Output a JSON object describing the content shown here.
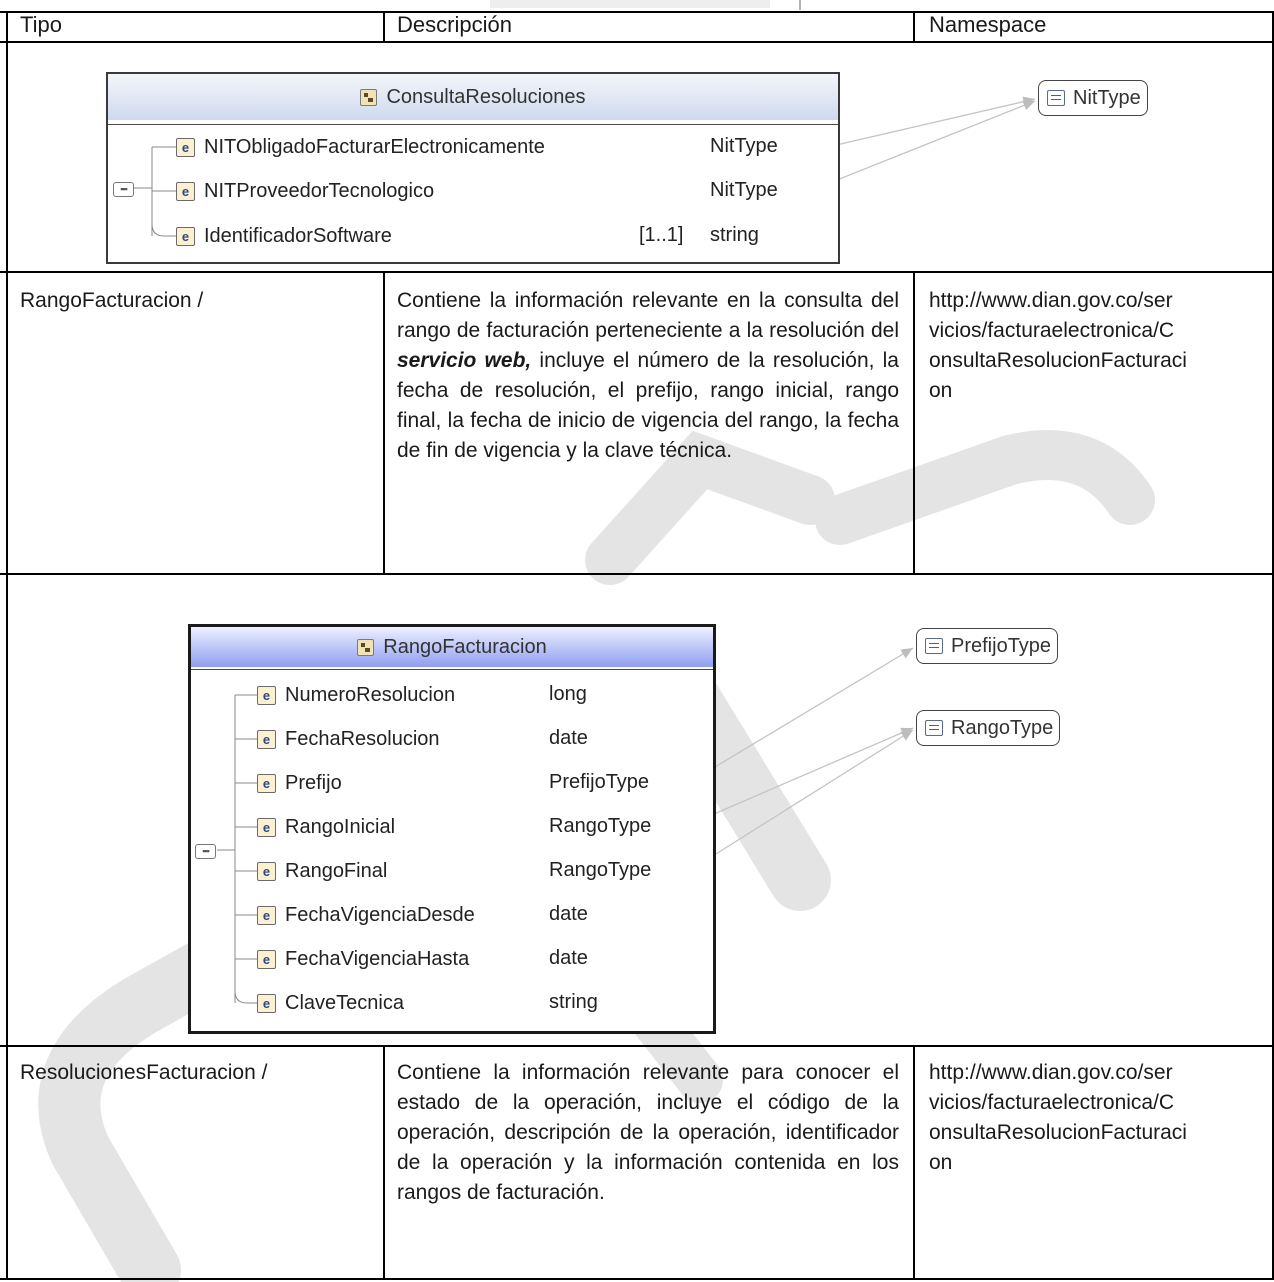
{
  "header": {
    "tipo": "Tipo",
    "descripcion": "Descripción",
    "namespace": "Namespace"
  },
  "diagram1": {
    "title": "ConsultaResoluciones",
    "elements": [
      {
        "name": "NITObligadoFacturarElectronicamente",
        "cardinality": "",
        "type": "NitType"
      },
      {
        "name": "NITProveedorTecnologico",
        "cardinality": "",
        "type": "NitType"
      },
      {
        "name": "IdentificadorSoftware",
        "cardinality": "[1..1]",
        "type": "string"
      }
    ],
    "types": [
      "NitType"
    ],
    "sequence_icon": "sequence-icon",
    "element_icon_label": "e",
    "colors": {
      "title_gradient_top": "#f4f6fb",
      "title_gradient_bottom": "#cfd9ee"
    }
  },
  "row1": {
    "tipo": "RangoFacturacion /",
    "descripcion_pre": "Contiene la información relevante en la consulta del rango de facturación perteneciente a la resolución del ",
    "descripcion_em": "servicio web,",
    "descripcion_post": " incluye el número de la resolución, la fecha de resolución, el prefijo, rango inicial, rango final, la fecha de inicio de vigencia del rango, la fecha de fin de vigencia y la clave técnica.",
    "namespace_lines": [
      "http://www.dian.gov.co/ser",
      "vicios/facturaelectronica/C",
      "onsultaResolucionFacturaci",
      "on"
    ]
  },
  "diagram2": {
    "title": "RangoFacturacion",
    "elements": [
      {
        "name": "NumeroResolucion",
        "type": "long"
      },
      {
        "name": "FechaResolucion",
        "type": "date"
      },
      {
        "name": "Prefijo",
        "type": "PrefijoType"
      },
      {
        "name": "RangoInicial",
        "type": "RangoType"
      },
      {
        "name": "RangoFinal",
        "type": "RangoType"
      },
      {
        "name": "FechaVigenciaDesde",
        "type": "date"
      },
      {
        "name": "FechaVigenciaHasta",
        "type": "date"
      },
      {
        "name": "ClaveTecnica",
        "type": "string"
      }
    ],
    "types": [
      "PrefijoType",
      "RangoType"
    ],
    "colors": {
      "title_gradient_top": "#eef0ff",
      "title_gradient_bottom": "#8f9ef0"
    }
  },
  "row2": {
    "tipo": "ResolucionesFacturacion /",
    "descripcion": "Contiene la información relevante para conocer el estado de la operación, incluye el código de la operación, descripción de la operación, identificador de la operación y la información contenida en los rangos de facturación.",
    "namespace_lines": [
      "http://www.dian.gov.co/ser",
      "vicios/facturaelectronica/C",
      "onsultaResolucionFacturaci",
      "on"
    ]
  },
  "colors": {
    "border": "#000000",
    "text": "#1a1a1a",
    "watermark": "#e6e6e6"
  }
}
